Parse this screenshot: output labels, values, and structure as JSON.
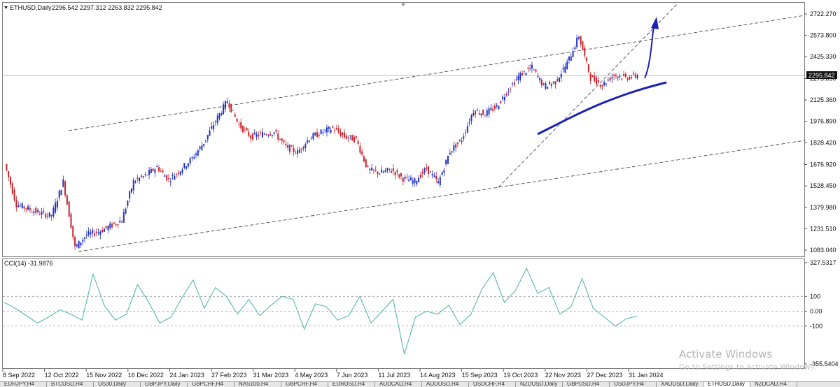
{
  "header": {
    "symbol_label": "ETHUSD,Daily",
    "ohlc": "2296.542 2297.312 2263.832 2295.842"
  },
  "current_price": "2295.842",
  "indicator": {
    "label": "CCI(14) -31.9876",
    "levels": [
      100,
      0,
      -100
    ]
  },
  "chart_data": {
    "type": "candlestick",
    "title": "ETHUSD,Daily",
    "x": [
      "8 Sep 2022",
      "12 Oct 2022",
      "15 Nov 2022",
      "16 Dec 2022",
      "24 Jan 2023",
      "27 Feb 2023",
      "31 Mar 2023",
      "4 May 2023",
      "7 Jun 2023",
      "11 Jul 2023",
      "14 Aug 2023",
      "15 Sep 2023",
      "19 Oct 2023",
      "22 Nov 2023",
      "27 Dec 2023",
      "31 Jan 2024"
    ],
    "series": [
      {
        "close": [
          1680,
          1400,
          1370,
          1340,
          1320,
          1560,
          1100,
          1190,
          1210,
          1250,
          1290,
          1560,
          1600,
          1660,
          1570,
          1640,
          1720,
          1830,
          1980,
          2120,
          1950,
          1870,
          1890,
          1900,
          1800,
          1760,
          1860,
          1900,
          1930,
          1870,
          1850,
          1640,
          1620,
          1640,
          1580,
          1560,
          1650,
          1550,
          1770,
          1850,
          2050,
          2030,
          2080,
          2200,
          2300,
          2350,
          2220,
          2250,
          2380,
          2570,
          2280,
          2230,
          2300,
          2280,
          2296
        ]
      }
    ],
    "y_tick_labels": [
      "2722.270",
      "2573.800",
      "2425.330",
      "2273.850",
      "2125.360",
      "1976.890",
      "1828.420",
      "1676.920",
      "1528.450",
      "1379.980",
      "1231.510",
      "1083.040"
    ],
    "ylim": [
      1010,
      2780
    ],
    "cci_series": [
      60,
      20,
      -30,
      -80,
      -40,
      10,
      -20,
      -60,
      250,
      40,
      -60,
      -20,
      180,
      60,
      -80,
      -40,
      90,
      210,
      20,
      160,
      100,
      -20,
      80,
      -30,
      40,
      100,
      80,
      -120,
      50,
      30,
      -60,
      -30,
      100,
      -80,
      0,
      80,
      -290,
      -40,
      0,
      -20,
      40,
      -90,
      -20,
      150,
      260,
      60,
      140,
      290,
      120,
      160,
      -20,
      30,
      220,
      20,
      -40,
      -100,
      -50,
      -32
    ],
    "cci_ylim": [
      -355.5404,
      327.5317
    ],
    "cci_tick_labels": [
      "327.5317",
      "100",
      "0.00",
      "-100",
      "-355.5404"
    ],
    "colors": {
      "bull": "#1f2fc2",
      "bear": "#c8202a",
      "cci": "#47b1a6",
      "trend": "#1a22b0",
      "channel": "#4a4a4a"
    }
  },
  "tabs": [
    "EURJPY,H4",
    "BTCUSD,H4",
    "US30,Daily",
    "GBPJPY,Daily",
    "GBPCHF,H4",
    "NAS100,H4",
    "GBPCHF,H4",
    "EURUSD,H4",
    "AUDCAD,H4",
    "AUDUSD,H4",
    "USDCHF,H4",
    "NZDUSD,Daily",
    "GBPUSD,H4",
    "USDJPY,H4",
    "XAUUSD,Daily",
    "ETHUSD,Daily",
    "NZDCAD,H4"
  ],
  "active_tab_index": 15,
  "watermark": {
    "line1": "Activate Windows",
    "line2": "Go to Settings to activate Windows."
  }
}
